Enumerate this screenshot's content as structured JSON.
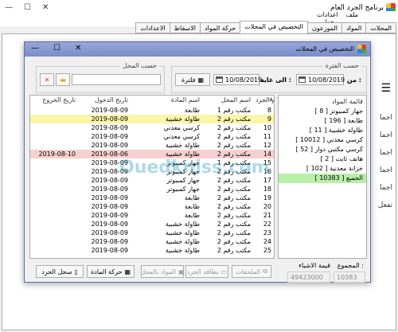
{
  "main": {
    "title": "برنامج الجرد العام",
    "menu": [
      "ملف",
      "اعدادات"
    ],
    "menu2": "حول",
    "tabs": [
      "المحلات",
      "المواد",
      "الموزعون",
      "التخصيص في المحلات",
      "حركة المواد",
      "الاسقاط",
      "الاعدادات"
    ],
    "active_tab": "التخصيص في المحلات",
    "side_labels": [
      "اجما",
      "اجما",
      "اجما",
      "اجما",
      "اجما",
      "تفعل"
    ]
  },
  "dialog": {
    "title": "التخصيص في المحلات",
    "period_group": "حسب الفترة",
    "from_label": "من :",
    "from_date": "10/08/2019",
    "to_label": "الى غاية :",
    "to_date": "10/08/2019",
    "filter_label": "فلترة",
    "store_group": "حسب المحل",
    "store_value": ""
  },
  "materials_list": {
    "header": "قائمة المواد",
    "items": [
      "جهاز كمبيوتر [ 8 ]",
      "طابعة [ 196 ]",
      "طاولة خشبية [ 11 ]",
      "كرسي معدني [ 10012 ]",
      "كرسي مكتبي دوار [ 52 ]",
      "هاتف ثابت [ 2 ]",
      "خزانة معدنية [ 102 ]",
      "الجميع [ 10383 ]"
    ],
    "selected_index": 7
  },
  "grid": {
    "headers": {
      "num": "رقم الجرد",
      "store": "اسم المحل",
      "material": "اسم المادة",
      "in": "تاريخ الدخول",
      "out": "تاريخ الخروج"
    },
    "rows": [
      {
        "num": "8",
        "store": "مكتب رقم 1",
        "material": "طابعة",
        "in": "2019-08-09",
        "out": "",
        "hl": ""
      },
      {
        "num": "9",
        "store": "مكتب رقم 2",
        "material": "طاولة خشبية",
        "in": "2019-08-09",
        "out": "",
        "hl": "yellow"
      },
      {
        "num": "10",
        "store": "مكتب رقم 2",
        "material": "كرسي معدني",
        "in": "2019-08-09",
        "out": "",
        "hl": ""
      },
      {
        "num": "11",
        "store": "مكتب رقم 2",
        "material": "كرسي معدني",
        "in": "2019-08-09",
        "out": "",
        "hl": ""
      },
      {
        "num": "12",
        "store": "مكتب رقم 2",
        "material": "طاولة خشبية",
        "in": "2019-08-09",
        "out": "",
        "hl": ""
      },
      {
        "num": "14",
        "store": "مكتب رقم 2",
        "material": "طاولة خشبية",
        "in": "2019-08-06",
        "out": "2019-08-10",
        "hl": "red"
      },
      {
        "num": "15",
        "store": "مكتب رقم 1",
        "material": "جهاز كمبيوتر",
        "in": "2019-08-09",
        "out": "",
        "hl": ""
      },
      {
        "num": "16",
        "store": "مكتب رقم 2",
        "material": "جهاز كمبيوتر",
        "in": "2019-08-09",
        "out": "",
        "hl": ""
      },
      {
        "num": "17",
        "store": "مكتب رقم 2",
        "material": "جهاز كمبيوتر",
        "in": "2019-08-09",
        "out": "",
        "hl": ""
      },
      {
        "num": "18",
        "store": "مكتب رقم 2",
        "material": "جهاز كمبيوتر",
        "in": "2019-08-09",
        "out": "",
        "hl": ""
      },
      {
        "num": "19",
        "store": "مكتب رقم 2",
        "material": "طابعة",
        "in": "2019-08-09",
        "out": "",
        "hl": ""
      },
      {
        "num": "20",
        "store": "مكتب رقم 2",
        "material": "طابعة",
        "in": "2019-08-09",
        "out": "",
        "hl": ""
      },
      {
        "num": "21",
        "store": "مكتب رقم 2",
        "material": "طابعة",
        "in": "2019-08-09",
        "out": "",
        "hl": ""
      },
      {
        "num": "22",
        "store": "مكتب رقم 2",
        "material": "طاولة خشبية",
        "in": "2019-08-09",
        "out": "",
        "hl": ""
      },
      {
        "num": "23",
        "store": "مكتب رقم 2",
        "material": "طاولة خشبية",
        "in": "2019-08-09",
        "out": "",
        "hl": ""
      },
      {
        "num": "24",
        "store": "مكتب رقم 2",
        "material": "طاولة خشبية",
        "in": "2019-08-09",
        "out": "",
        "hl": ""
      },
      {
        "num": "25",
        "store": "مكتب رقم 2",
        "material": "طاولة خشبية",
        "in": "2019-08-09",
        "out": "",
        "hl": ""
      }
    ]
  },
  "footer": {
    "total_label": "المجموع :",
    "total_value": "10383",
    "value_label": "قيمة الاشياء",
    "value_value": "49423000",
    "btn_attachments": "الملحقات",
    "btn_inventory_card": "بطاقة الجرد",
    "btn_store_materials": "المواد بالمحل",
    "btn_material_movement": "حركة المادة",
    "btn_inventory_record": "سجل الجرد"
  },
  "watermark": "Ouedkniss.com",
  "colors": {
    "selected_green": "#b8f0a8",
    "highlight_yellow": "#fbf6a8",
    "highlight_red": "#f8d0d0",
    "titlebar": "#8a9bd2"
  }
}
